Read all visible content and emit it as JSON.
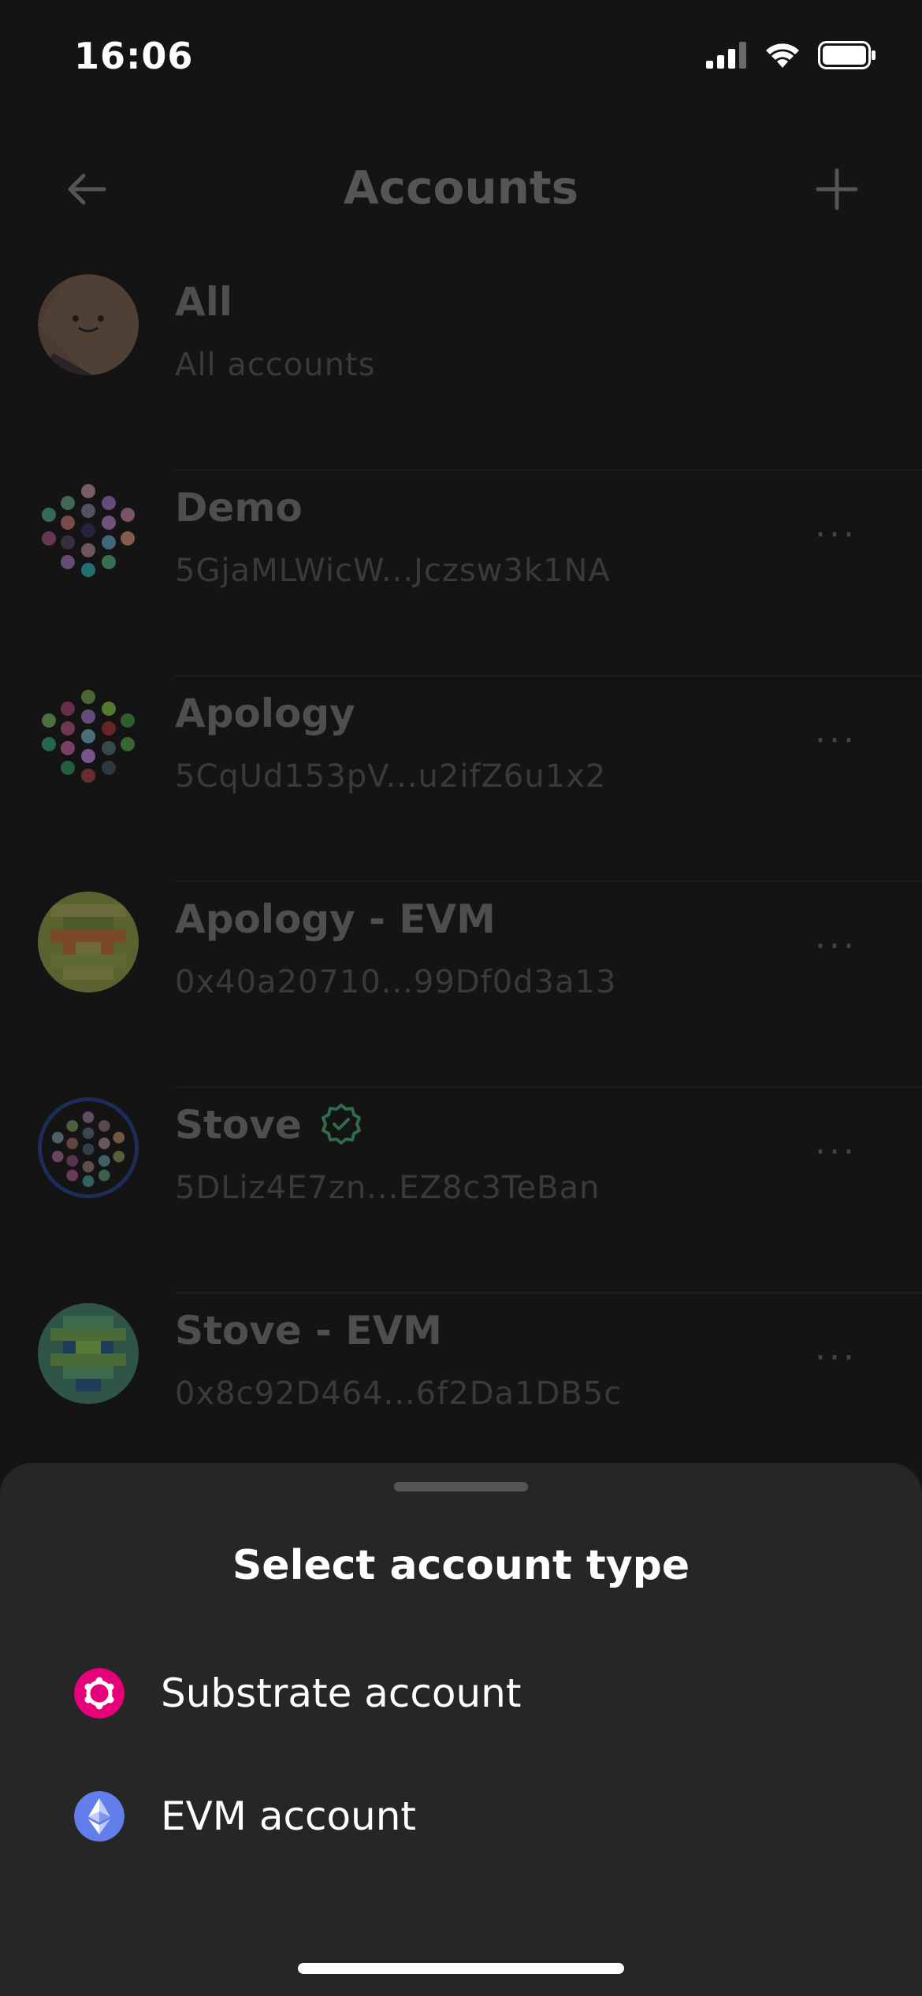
{
  "status": {
    "time": "16:06"
  },
  "nav": {
    "title": "Accounts"
  },
  "accounts": [
    {
      "name": "All",
      "address": "All accounts",
      "verified": false
    },
    {
      "name": "Demo",
      "address": "5GjaMLWicW...Jczsw3k1NA",
      "verified": false
    },
    {
      "name": "Apology",
      "address": "5CqUd153pV...u2ifZ6u1x2",
      "verified": false
    },
    {
      "name": "Apology - EVM",
      "address": "0x40a20710...99Df0d3a13",
      "verified": false
    },
    {
      "name": "Stove",
      "address": "5DLiz4E7zn...EZ8c3TeBan",
      "verified": true
    },
    {
      "name": "Stove - EVM",
      "address": "0x8c92D464...6f2Da1DB5c",
      "verified": false
    }
  ],
  "more_label": "···",
  "sheet": {
    "title": "Select account type",
    "options": [
      {
        "label": "Substrate account",
        "icon": "polkadot-icon",
        "color": "#E6007A"
      },
      {
        "label": "EVM account",
        "icon": "ethereum-icon",
        "color": "#627EEA"
      }
    ]
  }
}
